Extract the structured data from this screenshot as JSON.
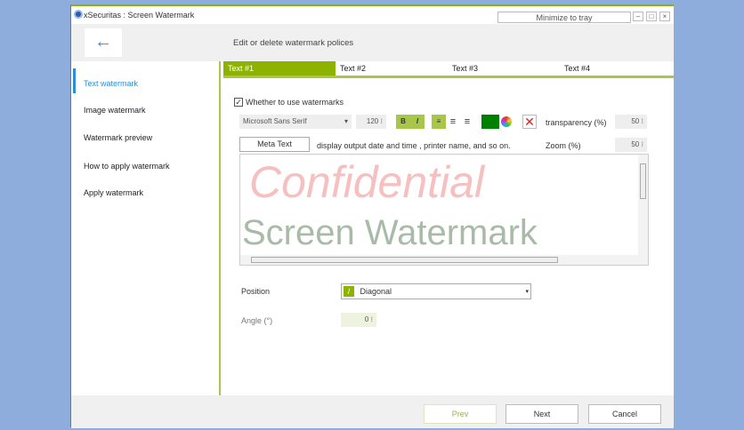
{
  "window": {
    "title": "xSecuritas : Screen Watermark",
    "minimize_to_tray": "Minimize to tray",
    "min": "–",
    "max": "□",
    "close": "×"
  },
  "header": {
    "back": "←",
    "title": "Edit or delete watermark polices"
  },
  "sidebar": {
    "items": [
      {
        "label": "Text watermark"
      },
      {
        "label": "Image watermark"
      },
      {
        "label": "Watermark preview"
      },
      {
        "label": "How to apply watermark"
      },
      {
        "label": "Apply watermark"
      }
    ]
  },
  "tabs": [
    {
      "label": "Text #1"
    },
    {
      "label": "Text #2"
    },
    {
      "label": "Text #3"
    },
    {
      "label": "Text #4"
    }
  ],
  "form": {
    "use_watermarks": "Whether to use watermarks",
    "checkmark": "✓",
    "font": "Microsoft Sans Serif",
    "font_size": "120",
    "bold": "B",
    "italic": "I",
    "color": "#008000",
    "transparency_label": "transparency (%)",
    "transparency": "50",
    "meta_text": "Meta Text",
    "meta_desc": "display output date and time , printer name, and so on.",
    "zoom_label": "Zoom (%)",
    "zoom": "50",
    "preview_line1": "Confidential",
    "preview_line2": "Screen Watermark",
    "position_label": "Position",
    "position": "Diagonal",
    "angle_label": "Angle (°)",
    "angle": "0"
  },
  "footer": {
    "prev": "Prev",
    "next": "Next",
    "cancel": "Cancel"
  }
}
